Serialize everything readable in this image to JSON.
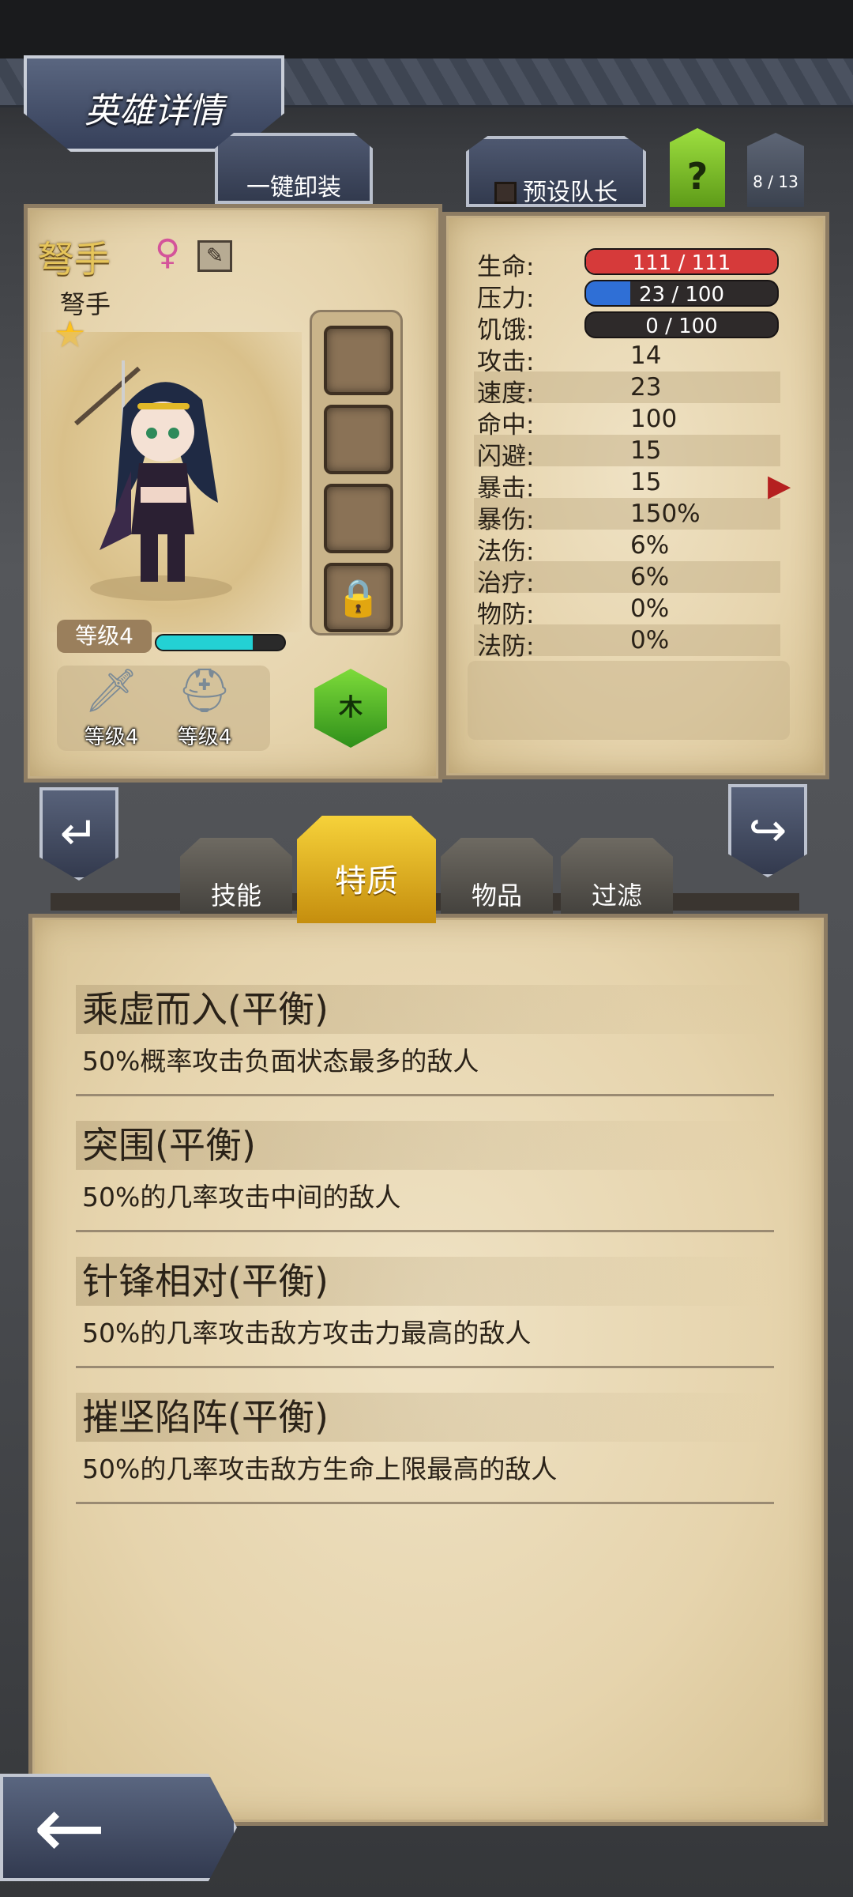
{
  "header": {
    "title": "英雄详情"
  },
  "toolbar": {
    "unequip_all": "一键卸装",
    "preset_leader": "预设队长",
    "help": "?",
    "page_count": "8 / 13"
  },
  "hero": {
    "name": "弩手",
    "class": "弩手",
    "gender_icon": "female-icon",
    "stars": "★",
    "level_label": "等级4",
    "xp_progress": 0.75,
    "element": "木",
    "equipment": [
      {
        "icon": "sword-icon",
        "label": "等级4"
      },
      {
        "icon": "helmet-icon",
        "label": "等级4"
      }
    ]
  },
  "stats": {
    "bars": [
      {
        "label": "生命:",
        "value": "111 / 111",
        "fraction": 1.0,
        "color": "#d63a3a"
      },
      {
        "label": "压力:",
        "value": "23 / 100",
        "fraction": 0.23,
        "color": "#2f6fd6"
      },
      {
        "label": "饥饿:",
        "value": "0 / 100",
        "fraction": 0.0,
        "color": "#4a4a4a"
      }
    ],
    "rows": [
      {
        "label": "攻击:",
        "value": "14"
      },
      {
        "label": "速度:",
        "value": "23"
      },
      {
        "label": "命中:",
        "value": "100"
      },
      {
        "label": "闪避:",
        "value": "15"
      },
      {
        "label": "暴击:",
        "value": "15"
      },
      {
        "label": "暴伤:",
        "value": "150%"
      },
      {
        "label": "法伤:",
        "value": "6%"
      },
      {
        "label": "治疗:",
        "value": "6%"
      },
      {
        "label": "物防:",
        "value": "0%"
      },
      {
        "label": "法防:",
        "value": "0%"
      }
    ]
  },
  "tabs": [
    {
      "label": "技能",
      "active": false
    },
    {
      "label": "特质",
      "active": true
    },
    {
      "label": "物品",
      "active": false
    },
    {
      "label": "过滤",
      "active": false
    }
  ],
  "traits": [
    {
      "title": "乘虚而入(平衡)",
      "desc": "50%概率攻击负面状态最多的敌人"
    },
    {
      "title": "突围(平衡)",
      "desc": "50%的几率攻击中间的敌人"
    },
    {
      "title": "针锋相对(平衡)",
      "desc": "50%的几率攻击敌方攻击力最高的敌人"
    },
    {
      "title": "摧坚陷阵(平衡)",
      "desc": "50%的几率攻击敌方生命上限最高的敌人"
    }
  ]
}
